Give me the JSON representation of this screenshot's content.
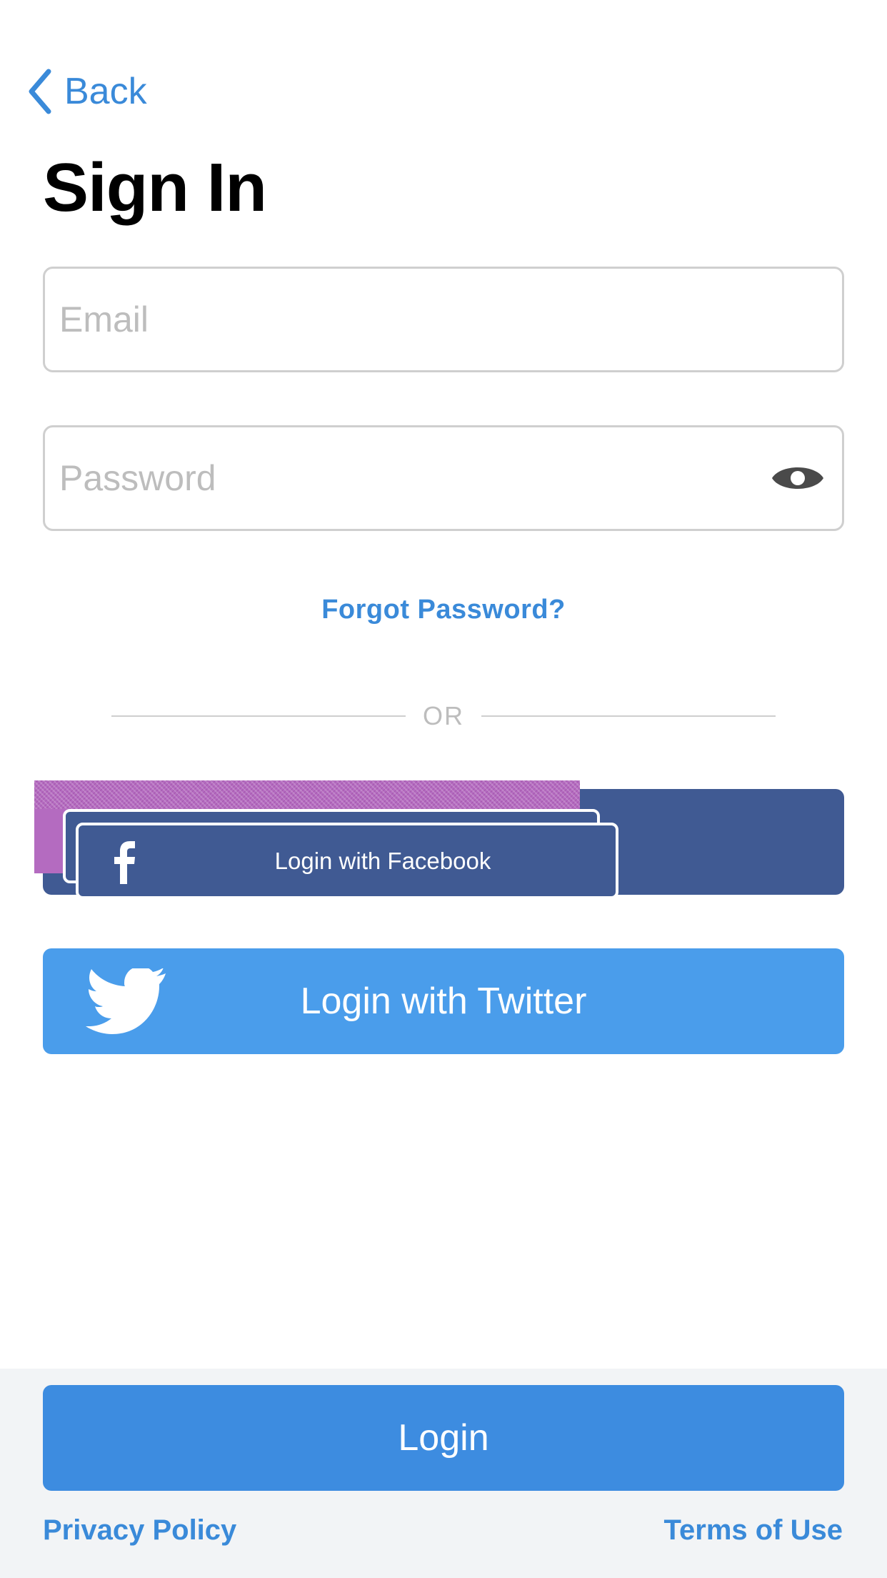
{
  "nav": {
    "back_label": "Back"
  },
  "title": "Sign In",
  "form": {
    "email_placeholder": "Email",
    "password_placeholder": "Password",
    "forgot_label": "Forgot Password?",
    "divider_label": "OR"
  },
  "social": {
    "facebook_label": "Login with Facebook",
    "twitter_label": "Login with Twitter"
  },
  "footer": {
    "login_label": "Login",
    "privacy_label": "Privacy Policy",
    "terms_label": "Terms of Use"
  },
  "icons": {
    "back": "chevron-left-icon",
    "password_toggle": "eye-icon",
    "facebook": "facebook-icon",
    "twitter": "twitter-icon"
  },
  "colors": {
    "accent": "#3a8ad9",
    "facebook": "#405a93",
    "twitter": "#4a9deb",
    "login_button": "#3d8ce0",
    "footer_bg": "#f2f4f6"
  }
}
